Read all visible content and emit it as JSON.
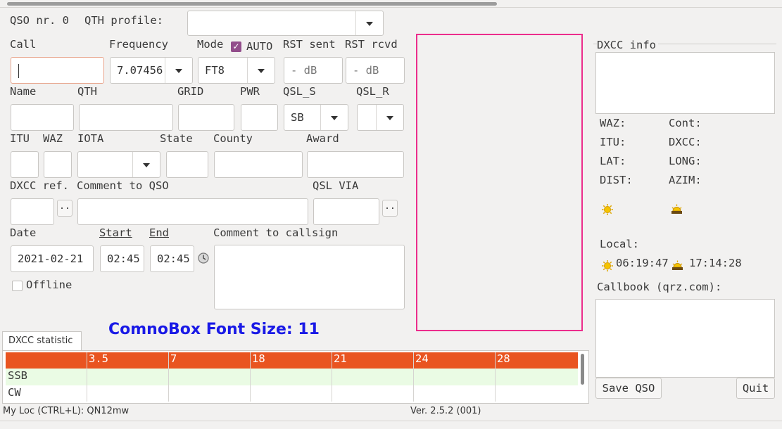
{
  "header": {
    "qso_nr": "QSO nr. 0",
    "qth_profile_label": "QTH profile:",
    "qth_profile_value": ""
  },
  "labels": {
    "call": "Call",
    "frequency": "Frequency",
    "mode": "Mode",
    "auto": "AUTO",
    "rst_sent": "RST sent",
    "rst_rcvd": "RST rcvd",
    "name": "Name",
    "qth": "QTH",
    "grid": "GRID",
    "pwr": "PWR",
    "qsl_s": "QSL_S",
    "qsl_r": "QSL_R",
    "itu": "ITU",
    "waz": "WAZ",
    "iota": "IOTA",
    "state": "State",
    "county": "County",
    "award": "Award",
    "dxcc_ref": "DXCC ref.",
    "comment_qso": "Comment to QSO",
    "qsl_via": "QSL VIA",
    "date": "Date",
    "start": "Start",
    "end": "End",
    "comment_callsign": "Comment to callsign",
    "offline": "Offline"
  },
  "values": {
    "call": "",
    "frequency": "7.07456",
    "mode": "FT8",
    "rst_sent": "- dB",
    "rst_rcvd": "- dB",
    "qsl_s": "SB",
    "qsl_r": "",
    "date": "2021-02-21",
    "start": "02:45",
    "end": "02:45",
    "dots": ".."
  },
  "overlay_note": "ComnoBox Font Size: 11",
  "dxcc_panel": {
    "title": "DXCC info",
    "waz": "WAZ:",
    "cont": "Cont:",
    "itu": "ITU:",
    "dxcc": "DXCC:",
    "lat": "LAT:",
    "long": "LONG:",
    "dist": "DIST:",
    "azim": "AZIM:",
    "local": "Local:",
    "sunrise": "06:19:47",
    "sunset": "17:14:28",
    "callbook": "Callbook (qrz.com):",
    "save": "Save QSO",
    "quit": "Quit"
  },
  "stats": {
    "tab": "DXCC statistic",
    "bands": [
      "",
      "3.5",
      "7",
      "18",
      "21",
      "24",
      "28"
    ],
    "rows": [
      "SSB",
      "CW"
    ]
  },
  "status": {
    "my_loc": "My Loc (CTRL+L): QN12mw",
    "version": "Ver. 2.5.2 (001)"
  },
  "colors": {
    "band_header": "#e95420",
    "ssb_row": "#eafbe4",
    "highlight_border": "#ec2d8c",
    "overlay_text": "#1a1ae6",
    "checkbox": "#924d8b"
  }
}
